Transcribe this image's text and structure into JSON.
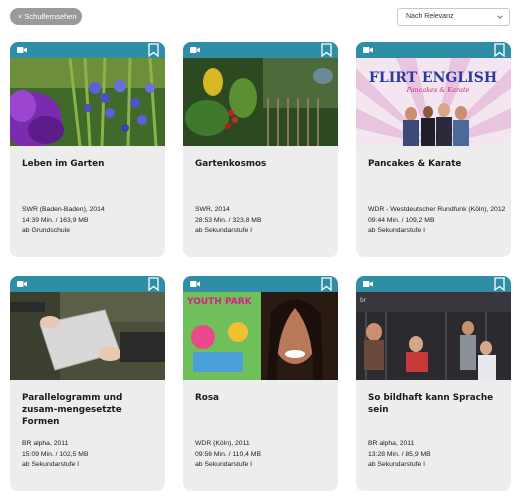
{
  "filter_chip": {
    "icon": "×",
    "label": "Schulfernsehen"
  },
  "sort_select": {
    "value": "Nach Relevanz"
  },
  "cards": [
    {
      "title": "Leben im Garten",
      "source": "SWR (Baden-Baden), 2014",
      "duration": "14:39 Min. / 163,9 MB",
      "level": "ab Grundschule"
    },
    {
      "title": "Gartenkosmos",
      "source": "SWR, 2014",
      "duration": "28:53 Min. / 323,8 MB",
      "level": "ab Sekundarstufe I"
    },
    {
      "title": "Pancakes & Karate",
      "source": "WDR - Westdeutscher Rundfunk (Köln), 2012",
      "duration": "09:44 Min. / 109,2 MB",
      "level": "ab Sekundarstufe I",
      "thumb_text": "FLIRT ENGLISH",
      "thumb_subtext": "Pancakes & Karate"
    },
    {
      "title": "Parallelogramm und zusam-mengesetzte Formen",
      "source": "BR alpha, 2011",
      "duration": "15:09 Min. / 102,5 MB",
      "level": "ab Sekundarstufe I"
    },
    {
      "title": "Rosa",
      "source": "WDR (Köln), 2011",
      "duration": "09:56 Min. / 110,4 MB",
      "level": "ab Sekundarstufe I",
      "thumb_text": "YOUTH PARK"
    },
    {
      "title": "So bildhaft kann Sprache sein",
      "source": "BR alpha, 2011",
      "duration": "13:28 Min. / 85,9 MB",
      "level": "ab Sekundarstufe I",
      "thumb_text": "br"
    }
  ],
  "colors": {
    "card_header": "#2e8ea6",
    "card_bg": "#ededed",
    "chip_bg": "#9a9a9a"
  },
  "icons": {
    "card_type": "video-camera-icon",
    "save": "bookmark-icon",
    "sort": "chevron-down-icon"
  }
}
